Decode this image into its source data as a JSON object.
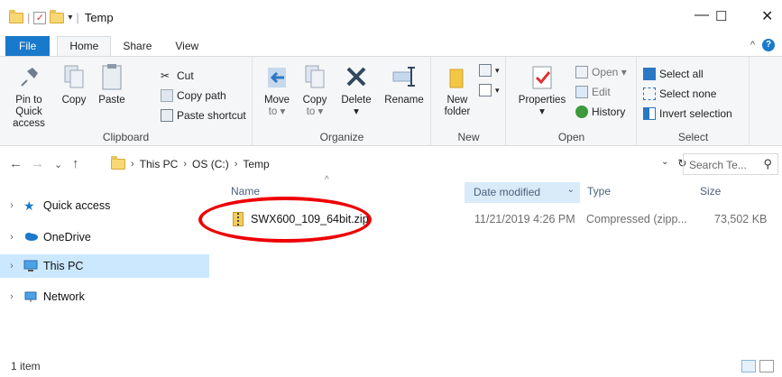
{
  "window": {
    "title": "Temp",
    "controls": {
      "minimize": "—",
      "maximize": "☐",
      "close": "✕"
    }
  },
  "ribbon_tabs": [
    {
      "label": "File"
    },
    {
      "label": "Home"
    },
    {
      "label": "Share"
    },
    {
      "label": "View"
    }
  ],
  "clipboard": {
    "group_label": "Clipboard",
    "pin_line1": "Pin to Quick",
    "pin_line2": "access",
    "copy": "Copy",
    "paste": "Paste",
    "cut": "Cut",
    "copy_path": "Copy path",
    "paste_shortcut": "Paste shortcut"
  },
  "organize": {
    "group_label": "Organize",
    "move_to": "Move",
    "move_to2": "to ▾",
    "copy_to": "Copy",
    "copy_to2": "to ▾",
    "delete": "Delete",
    "delete2": "▾",
    "rename": "Rename"
  },
  "new": {
    "group_label": "New",
    "new_folder1": "New",
    "new_folder2": "folder"
  },
  "open": {
    "group_label": "Open",
    "properties": "Properties",
    "properties2": "▾",
    "open": "Open ▾",
    "edit": "Edit",
    "history": "History"
  },
  "select": {
    "group_label": "Select",
    "select_all": "Select all",
    "select_none": "Select none",
    "invert": "Invert selection"
  },
  "address": {
    "crumbs": [
      "This PC",
      "OS (C:)",
      "Temp"
    ],
    "search_placeholder": "Search Te..."
  },
  "nav_pane": {
    "items": [
      {
        "label": "Quick access"
      },
      {
        "label": "OneDrive"
      },
      {
        "label": "This PC"
      },
      {
        "label": "Network"
      }
    ]
  },
  "columns": {
    "name": "Name",
    "date": "Date modified",
    "type": "Type",
    "size": "Size"
  },
  "files": [
    {
      "name": "SWX600_109_64bit.zip",
      "date": "11/21/2019 4:26 PM",
      "type": "Compressed (zipp...",
      "size": "73,502 KB"
    }
  ],
  "status": {
    "count": "1 item"
  },
  "colors": {
    "accent": "#1979ca",
    "selection": "#cce8ff",
    "highlight_circle": "#e00000"
  }
}
